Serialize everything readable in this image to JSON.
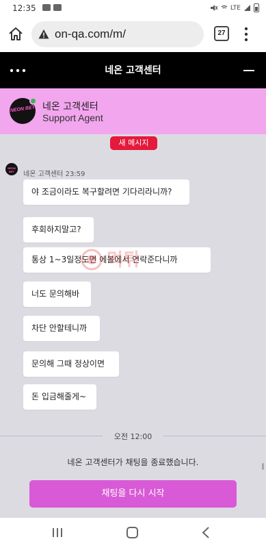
{
  "status_bar": {
    "time": "12:35",
    "network_label": "LTE"
  },
  "browser": {
    "url": "on-qa.com/m/",
    "tab_count": "27"
  },
  "app_header": {
    "title": "네온 고객센터"
  },
  "agent": {
    "avatar_text": "NEON BET",
    "name": "네온 고객센터",
    "role": "Support Agent",
    "online": true
  },
  "chat": {
    "new_message_badge": "새 메시지",
    "sender_name": "네온 고객센터",
    "sender_time": "23:59",
    "messages": [
      "야 조금이라도 복구할려면 기다리라니까?",
      "후회하지말고?",
      "통상 1~3일정도면 에볼에서 연락준다니까",
      "너도 문의해바",
      "차단 안할테니까",
      "문의해 그때 정상이면",
      "돈 입금해줄게~"
    ],
    "divider_time": "오전 12:00",
    "system_message": "네온 고객센터가 채팅을 종료했습니다.",
    "restart_button": "채팅을 다시 시작"
  },
  "watermark_text": "먹튀",
  "colors": {
    "header_bg": "#000000",
    "banner_bg": "#f2a6ee",
    "chat_bg": "#dddbe2",
    "badge_red": "#e5193c",
    "button_purple": "#d85ad6",
    "online_green": "#3ab54a"
  }
}
